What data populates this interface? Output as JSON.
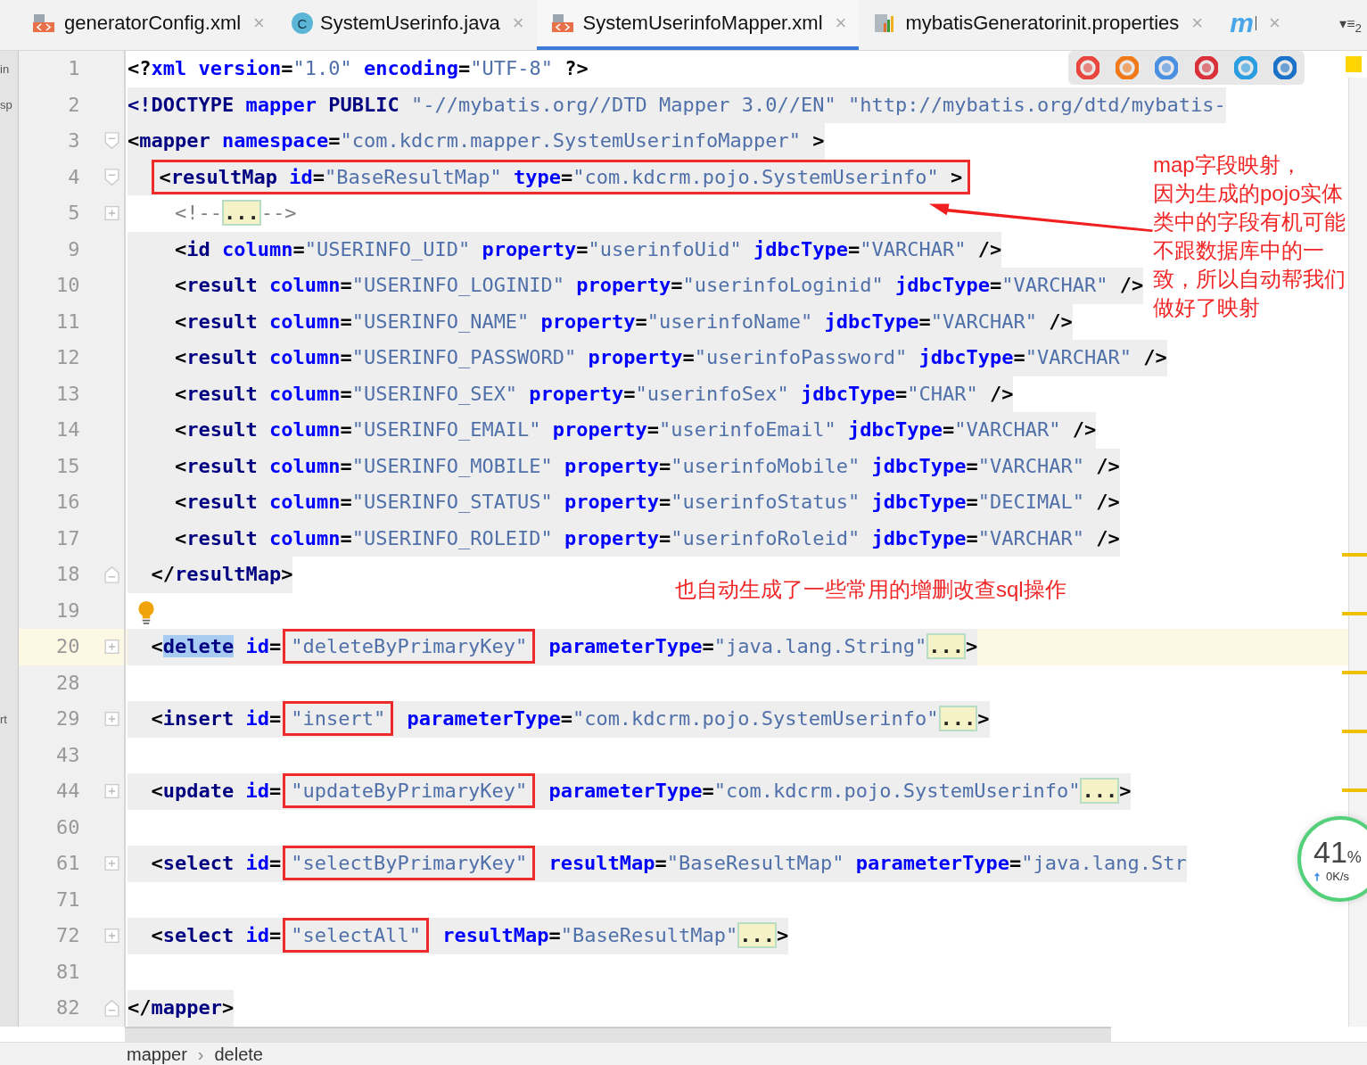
{
  "tabs": [
    {
      "kind": "xml",
      "label": "generatorConfig.xml",
      "close": "×",
      "selected": false
    },
    {
      "kind": "class",
      "badge": "C",
      "label": "SystemUserinfo.java",
      "close": "×",
      "selected": false
    },
    {
      "kind": "xml",
      "label": "SystemUserinfoMapper.xml",
      "close": "×",
      "selected": true
    },
    {
      "kind": "properties",
      "label": "mybatisGeneratorinit.properties",
      "close": "×",
      "selected": false
    },
    {
      "kind": "logo",
      "label": "m",
      "close": "×",
      "selected": false
    }
  ],
  "tab_overflow": {
    "label": "▾≡",
    "count": "2"
  },
  "lines": [
    {
      "num": "1",
      "side_text": "in",
      "shaded": false,
      "current": false,
      "tokens": [
        {
          "kind": "p",
          "text": "<?"
        },
        {
          "kind": "attr",
          "text": "xml"
        },
        {
          "kind": "attr",
          "text": " version"
        },
        {
          "kind": "p",
          "text": "="
        },
        {
          "kind": "val",
          "text": "\"1.0\""
        },
        {
          "kind": "attr",
          "text": " encoding"
        },
        {
          "kind": "p",
          "text": "="
        },
        {
          "kind": "val",
          "text": "\"UTF-8\""
        },
        {
          "kind": "p",
          "text": " ?>"
        }
      ]
    },
    {
      "num": "2",
      "side_text": "sp",
      "shaded": true,
      "current": false,
      "tokens": [
        {
          "kind": "tag",
          "text": "<!DOCTYPE"
        },
        {
          "kind": "attr",
          "text": " mapper"
        },
        {
          "kind": "tag",
          "text": " PUBLIC"
        },
        {
          "kind": "val",
          "text": " \"-//mybatis.org//DTD Mapper 3.0//EN\""
        },
        {
          "kind": "val",
          "text": " \"http://mybatis.org/dtd/mybatis-"
        }
      ]
    },
    {
      "num": "3",
      "fold": {
        "kind": "open"
      },
      "shaded": true,
      "current": false,
      "tokens": [
        {
          "kind": "p",
          "text": "<"
        },
        {
          "kind": "tag",
          "text": "mapper"
        },
        {
          "kind": "attr",
          "text": " namespace"
        },
        {
          "kind": "p",
          "text": "="
        },
        {
          "kind": "val",
          "text": "\"com.kdcrm.mapper.SystemUserinfoMapper\""
        },
        {
          "kind": "p",
          "text": " >"
        }
      ]
    },
    {
      "num": "4",
      "fold": {
        "kind": "open"
      },
      "shaded": true,
      "current": false,
      "boxed": true,
      "tokens": [
        {
          "kind": "p",
          "text": "  <"
        },
        {
          "kind": "tag",
          "text": "resultMap"
        },
        {
          "kind": "attr",
          "text": " id"
        },
        {
          "kind": "p",
          "text": "="
        },
        {
          "kind": "val",
          "text": "\"BaseResultMap\""
        },
        {
          "kind": "attr",
          "text": " type"
        },
        {
          "kind": "p",
          "text": "="
        },
        {
          "kind": "val",
          "text": "\"com.kdcrm.pojo.SystemUserinfo\""
        },
        {
          "kind": "p",
          "text": " >"
        }
      ]
    },
    {
      "num": "5",
      "fold": {
        "kind": "collapsed"
      },
      "shaded": false,
      "current": false,
      "tokens": [
        {
          "kind": "comment",
          "text": "    <!--"
        },
        {
          "kind": "fold",
          "text": "..."
        },
        {
          "kind": "comment",
          "text": "-->"
        }
      ]
    },
    {
      "num": "9",
      "shaded": true,
      "current": false,
      "tokens": [
        {
          "kind": "p",
          "text": "    <"
        },
        {
          "kind": "tag",
          "text": "id"
        },
        {
          "kind": "attr",
          "text": " column"
        },
        {
          "kind": "p",
          "text": "="
        },
        {
          "kind": "val",
          "text": "\"USERINFO_UID\""
        },
        {
          "kind": "attr",
          "text": " property"
        },
        {
          "kind": "p",
          "text": "="
        },
        {
          "kind": "val",
          "text": "\"userinfoUid\""
        },
        {
          "kind": "attr",
          "text": " jdbcType"
        },
        {
          "kind": "p",
          "text": "="
        },
        {
          "kind": "val",
          "text": "\"VARCHAR\""
        },
        {
          "kind": "p",
          "text": " />"
        }
      ]
    },
    {
      "num": "10",
      "shaded": true,
      "current": false,
      "tokens": [
        {
          "kind": "p",
          "text": "    <"
        },
        {
          "kind": "tag",
          "text": "result"
        },
        {
          "kind": "attr",
          "text": " column"
        },
        {
          "kind": "p",
          "text": "="
        },
        {
          "kind": "val",
          "text": "\"USERINFO_LOGINID\""
        },
        {
          "kind": "attr",
          "text": " property"
        },
        {
          "kind": "p",
          "text": "="
        },
        {
          "kind": "val",
          "text": "\"userinfoLoginid\""
        },
        {
          "kind": "attr",
          "text": " jdbcType"
        },
        {
          "kind": "p",
          "text": "="
        },
        {
          "kind": "val",
          "text": "\"VARCHAR\""
        },
        {
          "kind": "p",
          "text": " />"
        }
      ]
    },
    {
      "num": "11",
      "shaded": true,
      "current": false,
      "tokens": [
        {
          "kind": "p",
          "text": "    <"
        },
        {
          "kind": "tag",
          "text": "result"
        },
        {
          "kind": "attr",
          "text": " column"
        },
        {
          "kind": "p",
          "text": "="
        },
        {
          "kind": "val",
          "text": "\"USERINFO_NAME\""
        },
        {
          "kind": "attr",
          "text": " property"
        },
        {
          "kind": "p",
          "text": "="
        },
        {
          "kind": "val",
          "text": "\"userinfoName\""
        },
        {
          "kind": "attr",
          "text": " jdbcType"
        },
        {
          "kind": "p",
          "text": "="
        },
        {
          "kind": "val",
          "text": "\"VARCHAR\""
        },
        {
          "kind": "p",
          "text": " />"
        }
      ]
    },
    {
      "num": "12",
      "shaded": true,
      "current": false,
      "tokens": [
        {
          "kind": "p",
          "text": "    <"
        },
        {
          "kind": "tag",
          "text": "result"
        },
        {
          "kind": "attr",
          "text": " column"
        },
        {
          "kind": "p",
          "text": "="
        },
        {
          "kind": "val",
          "text": "\"USERINFO_PASSWORD\""
        },
        {
          "kind": "attr",
          "text": " property"
        },
        {
          "kind": "p",
          "text": "="
        },
        {
          "kind": "val",
          "text": "\"userinfoPassword\""
        },
        {
          "kind": "attr",
          "text": " jdbcType"
        },
        {
          "kind": "p",
          "text": "="
        },
        {
          "kind": "val",
          "text": "\"VARCHAR\""
        },
        {
          "kind": "p",
          "text": " />"
        }
      ]
    },
    {
      "num": "13",
      "shaded": true,
      "current": false,
      "tokens": [
        {
          "kind": "p",
          "text": "    <"
        },
        {
          "kind": "tag",
          "text": "result"
        },
        {
          "kind": "attr",
          "text": " column"
        },
        {
          "kind": "p",
          "text": "="
        },
        {
          "kind": "val",
          "text": "\"USERINFO_SEX\""
        },
        {
          "kind": "attr",
          "text": " property"
        },
        {
          "kind": "p",
          "text": "="
        },
        {
          "kind": "val",
          "text": "\"userinfoSex\""
        },
        {
          "kind": "attr",
          "text": " jdbcType"
        },
        {
          "kind": "p",
          "text": "="
        },
        {
          "kind": "val",
          "text": "\"CHAR\""
        },
        {
          "kind": "p",
          "text": " />"
        }
      ]
    },
    {
      "num": "14",
      "shaded": true,
      "current": false,
      "tokens": [
        {
          "kind": "p",
          "text": "    <"
        },
        {
          "kind": "tag",
          "text": "result"
        },
        {
          "kind": "attr",
          "text": " column"
        },
        {
          "kind": "p",
          "text": "="
        },
        {
          "kind": "val",
          "text": "\"USERINFO_EMAIL\""
        },
        {
          "kind": "attr",
          "text": " property"
        },
        {
          "kind": "p",
          "text": "="
        },
        {
          "kind": "val",
          "text": "\"userinfoEmail\""
        },
        {
          "kind": "attr",
          "text": " jdbcType"
        },
        {
          "kind": "p",
          "text": "="
        },
        {
          "kind": "val",
          "text": "\"VARCHAR\""
        },
        {
          "kind": "p",
          "text": " />"
        }
      ]
    },
    {
      "num": "15",
      "shaded": true,
      "current": false,
      "tokens": [
        {
          "kind": "p",
          "text": "    <"
        },
        {
          "kind": "tag",
          "text": "result"
        },
        {
          "kind": "attr",
          "text": " column"
        },
        {
          "kind": "p",
          "text": "="
        },
        {
          "kind": "val",
          "text": "\"USERINFO_MOBILE\""
        },
        {
          "kind": "attr",
          "text": " property"
        },
        {
          "kind": "p",
          "text": "="
        },
        {
          "kind": "val",
          "text": "\"userinfoMobile\""
        },
        {
          "kind": "attr",
          "text": " jdbcType"
        },
        {
          "kind": "p",
          "text": "="
        },
        {
          "kind": "val",
          "text": "\"VARCHAR\""
        },
        {
          "kind": "p",
          "text": " />"
        }
      ]
    },
    {
      "num": "16",
      "shaded": true,
      "current": false,
      "tokens": [
        {
          "kind": "p",
          "text": "    <"
        },
        {
          "kind": "tag",
          "text": "result"
        },
        {
          "kind": "attr",
          "text": " column"
        },
        {
          "kind": "p",
          "text": "="
        },
        {
          "kind": "val",
          "text": "\"USERINFO_STATUS\""
        },
        {
          "kind": "attr",
          "text": " property"
        },
        {
          "kind": "p",
          "text": "="
        },
        {
          "kind": "val",
          "text": "\"userinfoStatus\""
        },
        {
          "kind": "attr",
          "text": " jdbcType"
        },
        {
          "kind": "p",
          "text": "="
        },
        {
          "kind": "val",
          "text": "\"DECIMAL\""
        },
        {
          "kind": "p",
          "text": " />"
        }
      ]
    },
    {
      "num": "17",
      "shaded": true,
      "current": false,
      "tokens": [
        {
          "kind": "p",
          "text": "    <"
        },
        {
          "kind": "tag",
          "text": "result"
        },
        {
          "kind": "attr",
          "text": " column"
        },
        {
          "kind": "p",
          "text": "="
        },
        {
          "kind": "val",
          "text": "\"USERINFO_ROLEID\""
        },
        {
          "kind": "attr",
          "text": " property"
        },
        {
          "kind": "p",
          "text": "="
        },
        {
          "kind": "val",
          "text": "\"userinfoRoleid\""
        },
        {
          "kind": "attr",
          "text": " jdbcType"
        },
        {
          "kind": "p",
          "text": "="
        },
        {
          "kind": "val",
          "text": "\"VARCHAR\""
        },
        {
          "kind": "p",
          "text": " />"
        }
      ]
    },
    {
      "num": "18",
      "fold": {
        "kind": "close"
      },
      "shaded": true,
      "current": false,
      "tokens": [
        {
          "kind": "p",
          "text": "  </"
        },
        {
          "kind": "tag",
          "text": "resultMap"
        },
        {
          "kind": "p",
          "text": ">"
        }
      ]
    },
    {
      "num": "19",
      "current": false,
      "bulb": true
    },
    {
      "num": "20",
      "fold": {
        "kind": "collapsed"
      },
      "shaded": true,
      "current": true,
      "tokens": [
        {
          "kind": "p",
          "text": "  <"
        },
        {
          "kind": "tag",
          "text": "delete",
          "selected": true
        },
        {
          "kind": "attr",
          "text": " id"
        },
        {
          "kind": "p",
          "text": "="
        },
        {
          "kind": "val",
          "text": "\"deleteByPrimaryKey\"",
          "boxed": true
        },
        {
          "kind": "attr",
          "text": " parameterType"
        },
        {
          "kind": "p",
          "text": "="
        },
        {
          "kind": "val",
          "text": "\"java.lang.String\""
        },
        {
          "kind": "fold",
          "text": "..."
        },
        {
          "kind": "p",
          "text": ">"
        }
      ]
    },
    {
      "num": "28",
      "current": false
    },
    {
      "num": "29",
      "side_text": "rt",
      "fold": {
        "kind": "collapsed"
      },
      "shaded": true,
      "current": false,
      "tokens": [
        {
          "kind": "p",
          "text": "  <"
        },
        {
          "kind": "tag",
          "text": "insert"
        },
        {
          "kind": "attr",
          "text": " id"
        },
        {
          "kind": "p",
          "text": "="
        },
        {
          "kind": "val",
          "text": "\"insert\"",
          "boxed": true
        },
        {
          "kind": "attr",
          "text": " parameterType"
        },
        {
          "kind": "p",
          "text": "="
        },
        {
          "kind": "val",
          "text": "\"com.kdcrm.pojo.SystemUserinfo\""
        },
        {
          "kind": "fold",
          "text": "..."
        },
        {
          "kind": "p",
          "text": ">"
        }
      ]
    },
    {
      "num": "43",
      "current": false
    },
    {
      "num": "44",
      "fold": {
        "kind": "collapsed"
      },
      "shaded": true,
      "current": false,
      "tokens": [
        {
          "kind": "p",
          "text": "  <"
        },
        {
          "kind": "tag",
          "text": "update"
        },
        {
          "kind": "attr",
          "text": " id"
        },
        {
          "kind": "p",
          "text": "="
        },
        {
          "kind": "val",
          "text": "\"updateByPrimaryKey\"",
          "boxed": true
        },
        {
          "kind": "attr",
          "text": " parameterType"
        },
        {
          "kind": "p",
          "text": "="
        },
        {
          "kind": "val",
          "text": "\"com.kdcrm.pojo.SystemUserinfo\""
        },
        {
          "kind": "fold",
          "text": "..."
        },
        {
          "kind": "p",
          "text": ">"
        }
      ]
    },
    {
      "num": "60",
      "current": false
    },
    {
      "num": "61",
      "fold": {
        "kind": "collapsed"
      },
      "shaded": true,
      "current": false,
      "tokens": [
        {
          "kind": "p",
          "text": "  <"
        },
        {
          "kind": "tag",
          "text": "select"
        },
        {
          "kind": "attr",
          "text": " id"
        },
        {
          "kind": "p",
          "text": "="
        },
        {
          "kind": "val",
          "text": "\"selectByPrimaryKey\"",
          "boxed": true
        },
        {
          "kind": "attr",
          "text": " resultMap"
        },
        {
          "kind": "p",
          "text": "="
        },
        {
          "kind": "val",
          "text": "\"BaseResultMap\""
        },
        {
          "kind": "attr",
          "text": " parameterType"
        },
        {
          "kind": "p",
          "text": "="
        },
        {
          "kind": "val",
          "text": "\"java.lang.Str"
        }
      ]
    },
    {
      "num": "71",
      "current": false
    },
    {
      "num": "72",
      "fold": {
        "kind": "collapsed"
      },
      "shaded": true,
      "current": false,
      "tokens": [
        {
          "kind": "p",
          "text": "  <"
        },
        {
          "kind": "tag",
          "text": "select"
        },
        {
          "kind": "attr",
          "text": " id"
        },
        {
          "kind": "p",
          "text": "="
        },
        {
          "kind": "val",
          "text": "\"selectAll\"",
          "boxed": true
        },
        {
          "kind": "attr",
          "text": " resultMap"
        },
        {
          "kind": "p",
          "text": "="
        },
        {
          "kind": "val",
          "text": "\"BaseResultMap\""
        },
        {
          "kind": "fold",
          "text": "..."
        },
        {
          "kind": "p",
          "text": ">"
        }
      ]
    },
    {
      "num": "81",
      "current": false
    },
    {
      "num": "82",
      "fold": {
        "kind": "close"
      },
      "shaded": true,
      "current": false,
      "tokens": [
        {
          "kind": "p",
          "text": "</"
        },
        {
          "kind": "tag",
          "text": "mapper"
        },
        {
          "kind": "p",
          "text": ">"
        }
      ]
    }
  ],
  "annotations": [
    {
      "kind": "callout",
      "title": "map字段映射，",
      "text": "因为生成的pojo实体类中的字段有机可能不跟数据库中的一致，所以自动帮我们做好了映射"
    },
    {
      "kind": "note",
      "text": "也自动生成了一些常用的增删改查sql操作"
    }
  ],
  "speed_widget": {
    "percent": "41",
    "unit": "%",
    "rate": "0K/s"
  },
  "breadcrumb": {
    "items": [
      "mapper",
      "delete"
    ],
    "separator": "›"
  }
}
